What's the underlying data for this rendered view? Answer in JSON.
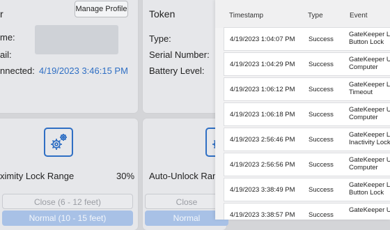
{
  "profile_card": {
    "title_fragment": "r",
    "manage_button": "Manage Profile",
    "fields": [
      {
        "label": "me:"
      },
      {
        "label": "ail:"
      },
      {
        "label": "nnected:",
        "value": "4/19/2023 3:46:15 PM"
      }
    ]
  },
  "token_card": {
    "title": "Token",
    "fields": [
      "Type:",
      "Serial Number:",
      "Battery Level:"
    ]
  },
  "proximity_card": {
    "icon": "gears-icon",
    "label": "ximity Lock Range",
    "percent": "30%",
    "options": [
      "Close (6 - 12 feet)",
      "Normal (10 - 15 feet)"
    ]
  },
  "autounlock_card": {
    "icon": "gears-icon",
    "label": "Auto-Unlock Rang",
    "options": [
      "Close",
      "Normal"
    ]
  },
  "log": {
    "columns": [
      "Timestamp",
      "Type",
      "Event"
    ],
    "rows": [
      {
        "timestamp": "4/19/2023 1:04:07 PM",
        "type": "Success",
        "event": [
          "GateKeeper Lo",
          "Button Lock"
        ]
      },
      {
        "timestamp": "4/19/2023 1:04:29 PM",
        "type": "Success",
        "event": [
          "GateKeeper Un",
          "Computer"
        ]
      },
      {
        "timestamp": "4/19/2023 1:06:12 PM",
        "type": "Success",
        "event": [
          "GateKeeper Lo",
          "Timeout"
        ]
      },
      {
        "timestamp": "4/19/2023 1:06:18 PM",
        "type": "Success",
        "event": [
          "GateKeeper Un",
          "Computer"
        ]
      },
      {
        "timestamp": "4/19/2023 2:56:46 PM",
        "type": "Success",
        "event": [
          "GateKeeper Lo",
          "Inactivity Lock"
        ]
      },
      {
        "timestamp": "4/19/2023 2:56:56 PM",
        "type": "Success",
        "event": [
          "GateKeeper Un",
          "Computer"
        ]
      },
      {
        "timestamp": "4/19/2023 3:38:49 PM",
        "type": "Success",
        "event": [
          "GateKeeper Lo",
          "Button Lock"
        ]
      },
      {
        "timestamp": "4/19/2023 3:38:57 PM",
        "type": "Success",
        "event": [
          "GateKeeper Un",
          ""
        ]
      }
    ]
  },
  "colors": {
    "accent": "#2f6fc4",
    "panel": "#e6e7ea",
    "background": "#d4d5d8"
  }
}
